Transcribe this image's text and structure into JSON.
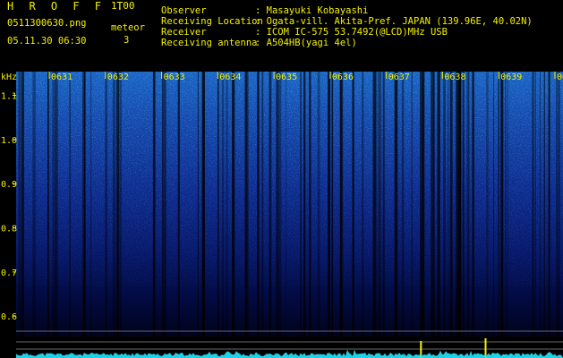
{
  "app": {
    "title": "H R O F F T",
    "version": "1.00"
  },
  "file_name": "0511300630.png",
  "timestamp": "05.11.30 06:30",
  "counter": {
    "label": "meteor",
    "value": "3"
  },
  "info": [
    {
      "label": "Observer",
      "value": ": Masayuki Kobayashi"
    },
    {
      "label": "Receiving Location",
      "value": ": Ogata-vill. Akita-Pref. JAPAN (139.96E, 40.02N)"
    },
    {
      "label": "Receiver",
      "value": ": ICOM IC-575 53.7492(@LCD)MHz USB"
    },
    {
      "label": "Receiving antenna",
      "value": ": A504HB(yagi 4el)"
    }
  ],
  "colors": {
    "text_yellow": "#f4f000",
    "text_green": "#3fe020",
    "signal_cyan": "#20e8ff"
  },
  "chart_data": {
    "type": "heatmap",
    "y_unit": "kHz",
    "y_ticks": [
      "0.6",
      "0.7",
      "0.8",
      "0.9",
      "1.0",
      "1.1"
    ],
    "y_range": [
      0.57,
      1.17
    ],
    "x_ticks": [
      "0631",
      "0632",
      "0633",
      "0634",
      "0635",
      "0636",
      "0637",
      "0638",
      "0639",
      "0640"
    ],
    "x_range_minutes": [
      0,
      10
    ],
    "meteor_echoes_minutes": [
      7.6,
      8.75
    ]
  }
}
